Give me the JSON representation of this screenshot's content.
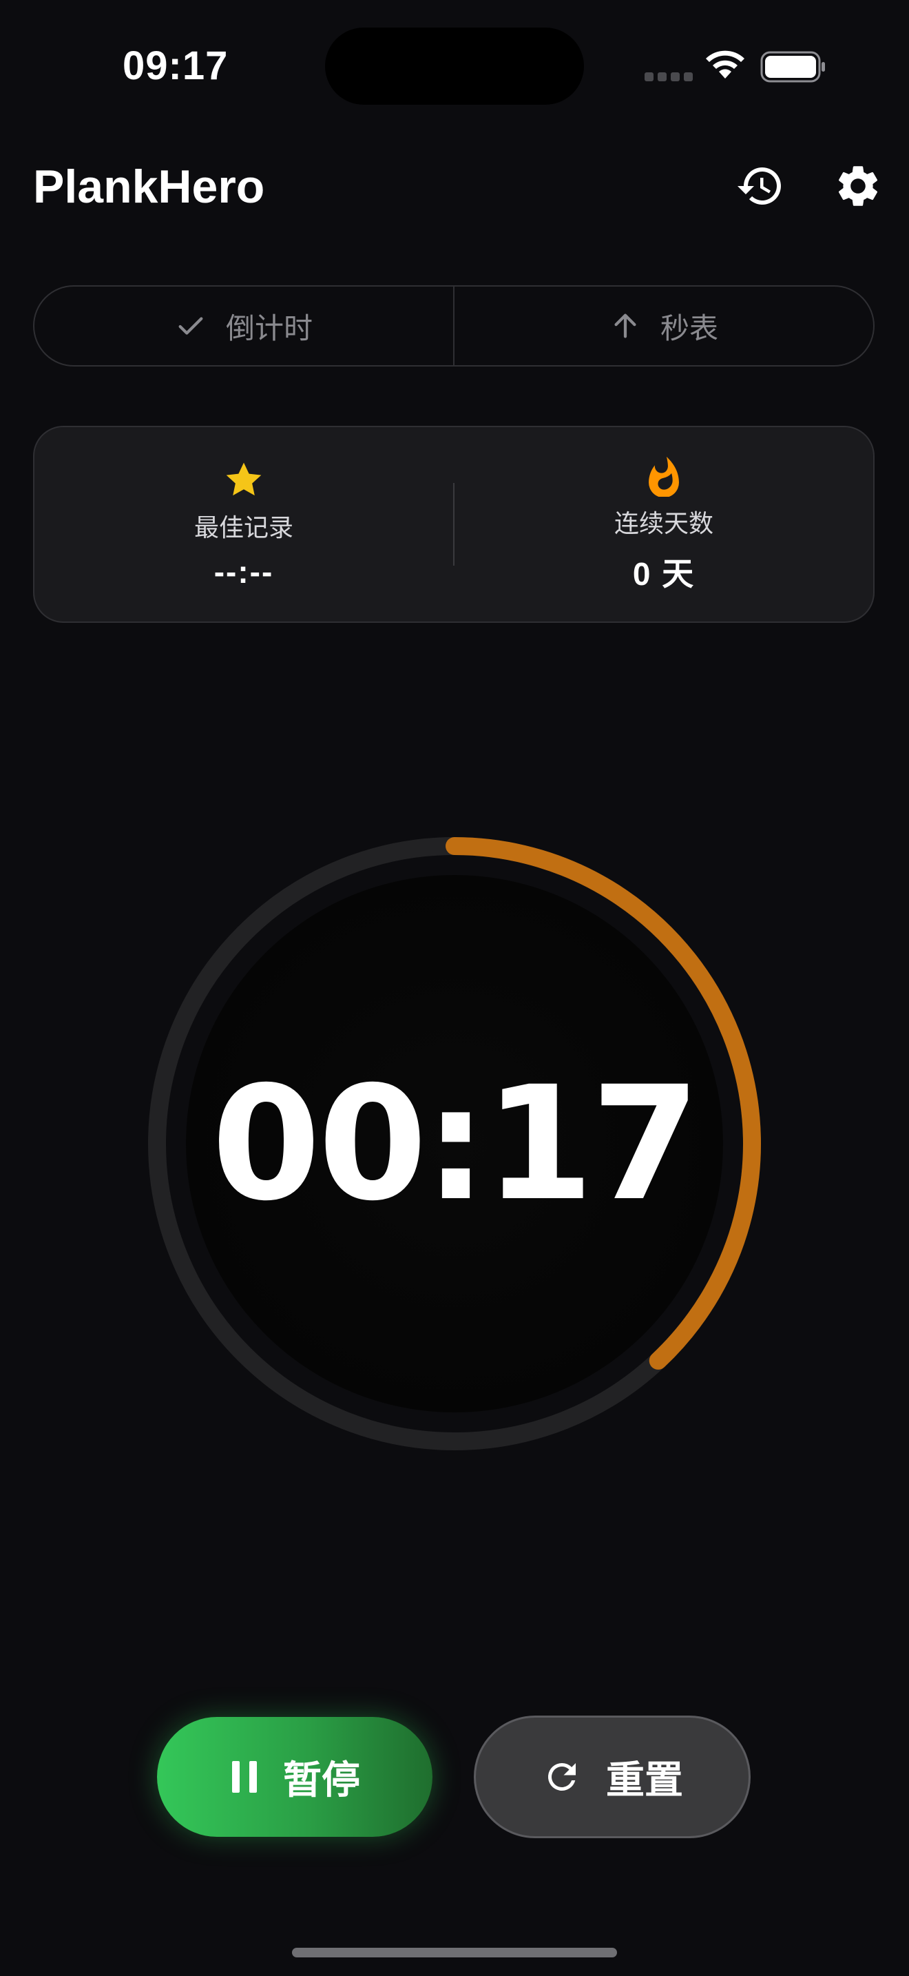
{
  "status_bar": {
    "time": "09:17"
  },
  "header": {
    "app_title": "PlankHero"
  },
  "mode_toggle": {
    "countdown_label": "倒计时",
    "stopwatch_label": "秒表"
  },
  "stats": {
    "best_record_label": "最佳记录",
    "best_record_value": "--:--",
    "streak_label": "连续天数",
    "streak_value": "0 天"
  },
  "timer": {
    "display": "00:17",
    "progress_fraction": 0.38,
    "track_color": "#222224",
    "progress_color": "#c16f12"
  },
  "controls": {
    "pause_label": "暂停",
    "reset_label": "重置"
  },
  "colors": {
    "accent_green": "#34c759",
    "star": "#f5c518",
    "flame": "#ff9500"
  },
  "icons": {
    "history": "history-icon",
    "settings": "gear-icon",
    "check": "checkmark-icon",
    "arrow_up": "arrow-up-icon",
    "star": "star-icon",
    "flame": "flame-icon",
    "pause": "pause-icon",
    "reset": "reset-icon"
  }
}
